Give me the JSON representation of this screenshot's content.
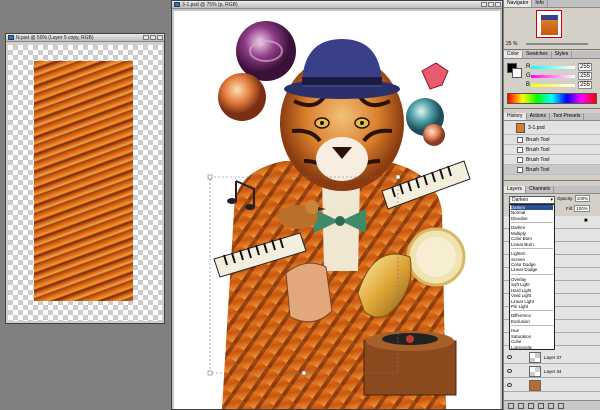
{
  "left_window": {
    "title": "N.psd @ 50% (Layer 5 copy, RGB)"
  },
  "main_window": {
    "title": "3-1.psd @ 75% (p, RGB)"
  },
  "navigator": {
    "tabs": [
      "Navigator",
      "Info"
    ],
    "zoom": "25 %"
  },
  "color_panel": {
    "tabs": [
      "Color",
      "Swatches",
      "Styles"
    ],
    "r_label": "R",
    "g_label": "G",
    "b_label": "B",
    "r": "255",
    "g": "255",
    "b": "255"
  },
  "history": {
    "tabs": [
      "History",
      "Actions",
      "Tool Presets"
    ],
    "snapshot": "3-1.psd",
    "items": [
      "Brush Tool",
      "Brush Tool",
      "Brush Tool",
      "Brush Tool"
    ]
  },
  "layers": {
    "tabs": [
      "Layers",
      "Channels"
    ],
    "blend_mode": "Darken",
    "opacity_label": "Opacity:",
    "opacity": "100%",
    "fill_label": "Fill:",
    "fill": "100%",
    "blend_options": [
      "Darken",
      "Normal",
      "Dissolve",
      "---",
      "Darken",
      "Multiply",
      "Color Burn",
      "Linear Burn",
      "---",
      "Lighten",
      "Screen",
      "Color Dodge",
      "Linear Dodge",
      "---",
      "Overlay",
      "Soft Light",
      "Hard Light",
      "Vivid Light",
      "Linear Light",
      "Pin Light",
      "---",
      "Difference",
      "Exclusion",
      "---",
      "Hue",
      "Saturation",
      "Color",
      "Luminosity"
    ],
    "rows": [
      "Layer 37",
      "Layer 34",
      ""
    ]
  },
  "colors": {
    "accent": "#2a4f9a",
    "panel": "#d4d0c8",
    "workspace": "#808080"
  }
}
